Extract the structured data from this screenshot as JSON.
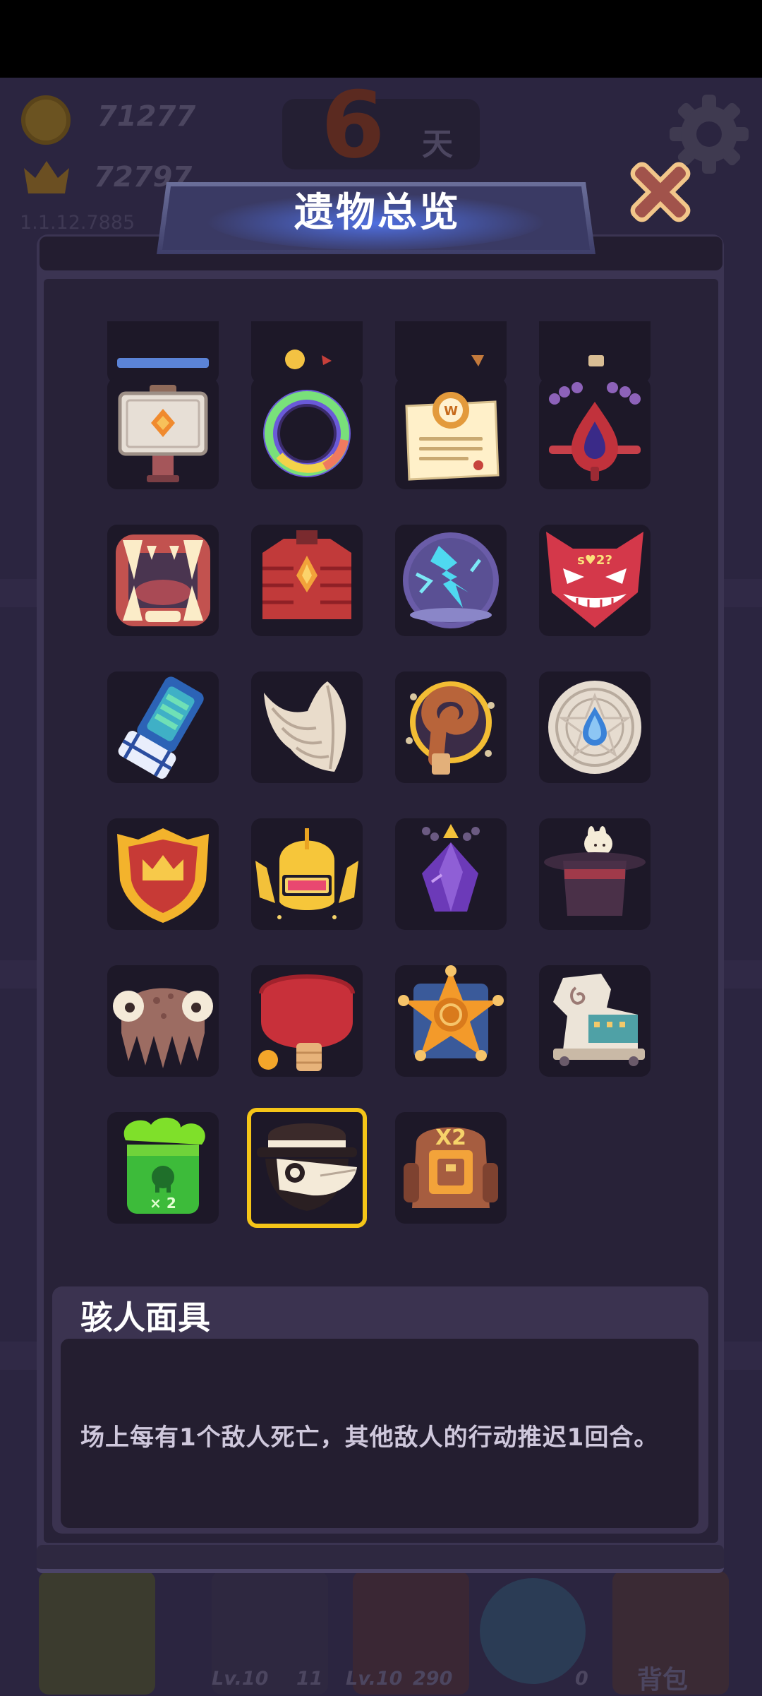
{
  "hud": {
    "coins": "71277",
    "crowns": "72797",
    "version": "1.1.12.7885",
    "day_number": "6",
    "day_unit": "天",
    "bottom_bar": [
      {
        "level": "Lv.10",
        "count": "11"
      },
      {
        "level": "Lv.10",
        "count": "290"
      },
      {
        "level": "",
        "count": "0"
      }
    ],
    "backpack_label": "背包"
  },
  "dialog": {
    "title": "遗物总览",
    "selected_relic": {
      "name": "骇人面具",
      "description": "场上每有1个敌人死亡，其他敌人的行动推迟1回合。"
    }
  },
  "relics": [
    {
      "icon": "partial-blue-relic-icon"
    },
    {
      "icon": "partial-gold-relic-icon"
    },
    {
      "icon": "partial-brown-relic-icon"
    },
    {
      "icon": "partial-tan-relic-icon"
    },
    {
      "icon": "stone-signpost-icon"
    },
    {
      "icon": "rainbow-ring-icon"
    },
    {
      "icon": "certificate-scroll-icon"
    },
    {
      "icon": "blood-drop-necklace-icon"
    },
    {
      "icon": "fanged-mouth-icon"
    },
    {
      "icon": "red-armor-icon"
    },
    {
      "icon": "lightning-orb-icon"
    },
    {
      "icon": "demon-mask-icon"
    },
    {
      "icon": "blue-gauntlet-icon"
    },
    {
      "icon": "angel-wing-icon"
    },
    {
      "icon": "spiral-staff-icon"
    },
    {
      "icon": "water-rune-plate-icon"
    },
    {
      "icon": "crown-shield-icon"
    },
    {
      "icon": "golden-knight-helmet-icon"
    },
    {
      "icon": "purple-crystal-amulet-icon"
    },
    {
      "icon": "magic-top-hat-icon"
    },
    {
      "icon": "octopus-icon"
    },
    {
      "icon": "ping-pong-paddle-icon"
    },
    {
      "icon": "sheriff-star-badge-icon"
    },
    {
      "icon": "trojan-horse-icon"
    },
    {
      "icon": "toxic-jar-x2-icon",
      "label": "× 2"
    },
    {
      "icon": "plague-mask-icon",
      "selected": true
    },
    {
      "icon": "backpack-x2-icon",
      "label": "X2"
    }
  ],
  "colors": {
    "selection_border": "#f5c518",
    "dialog_frame": "#3b3452",
    "slot_background": "#1d1828"
  }
}
